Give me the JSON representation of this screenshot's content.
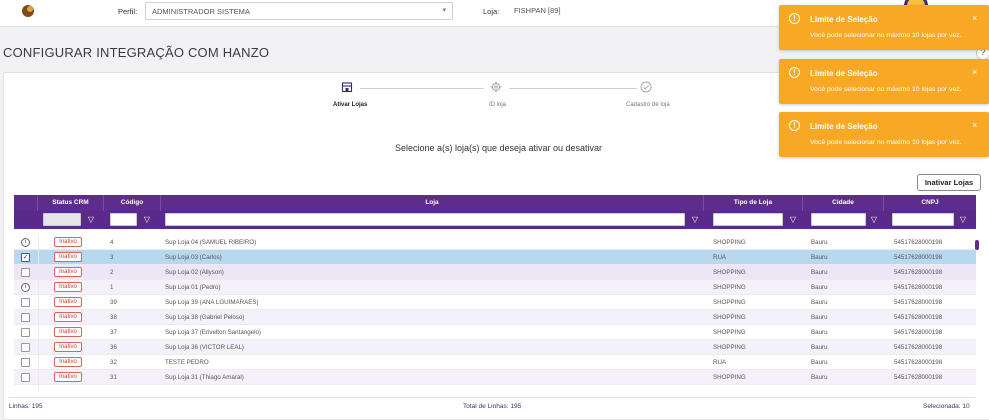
{
  "header": {
    "perfil_label": "Perfil:",
    "perfil_value": "ADMINISTRADOR SISTEMA",
    "loja_label": "Loja:",
    "loja_value": "FISHPAN [89]"
  },
  "page": {
    "title": "CONFIGURAR INTEGRAÇÃO COM HANZO",
    "instruction": "Selecione a(s) loja(s) que deseja ativar ou desativar",
    "inativar_button": "Inativar Lojas"
  },
  "stepper": [
    {
      "label": "Ativar Lojas",
      "icon": "store-icon",
      "active": true
    },
    {
      "label": "ID loja",
      "icon": "gear-icon",
      "active": false
    },
    {
      "label": "Cadastro de loja",
      "icon": "check-circle-icon",
      "active": false
    }
  ],
  "grid": {
    "columns": [
      "Status CRM",
      "Código",
      "Loja",
      "Tipo de Loja",
      "Cidade",
      "CNPJ"
    ],
    "rows": [
      {
        "mark": "info",
        "status": "Inativo",
        "codigo": "4",
        "loja": "Sup Loja 04 (SAMUEL RIBEIRO)",
        "tipo": "SHOPPING",
        "cidade": "Bauru",
        "cnpj": "54517628000198"
      },
      {
        "mark": "checked",
        "status": "Inativo",
        "codigo": "3",
        "loja": "Sup Loja 03 (Carlos)",
        "tipo": "RUA",
        "cidade": "Bauru",
        "cnpj": "54517628000198"
      },
      {
        "mark": "box",
        "status": "Inativo",
        "codigo": "2",
        "loja": "Sup Loja 02 (Allyson)",
        "tipo": "SHOPPING",
        "cidade": "Bauru",
        "cnpj": "54517628000198"
      },
      {
        "mark": "info",
        "status": "Inativo",
        "codigo": "1",
        "loja": "Sup Loja 01 (Pedro)",
        "tipo": "SHOPPING",
        "cidade": "Bauru",
        "cnpj": "54517628000198"
      },
      {
        "mark": "box",
        "status": "Inativo",
        "codigo": "39",
        "loja": "Sup Loja 39 (ANA LGUIMARAES)",
        "tipo": "SHOPPING",
        "cidade": "Bauru",
        "cnpj": "54517628000198"
      },
      {
        "mark": "box",
        "status": "Inativo",
        "codigo": "38",
        "loja": "Sup Loja 38 (Gabriel Peloso)",
        "tipo": "SHOPPING",
        "cidade": "Bauru",
        "cnpj": "54517628000198"
      },
      {
        "mark": "box",
        "status": "Inativo",
        "codigo": "37",
        "loja": "Sup Loja 37 (Erivelton Santangelo)",
        "tipo": "SHOPPING",
        "cidade": "Bauru",
        "cnpj": "54517628000198"
      },
      {
        "mark": "box",
        "status": "Inativo",
        "codigo": "36",
        "loja": "Sup Loja 36 (VICTOR LEAL)",
        "tipo": "SHOPPING",
        "cidade": "Bauru",
        "cnpj": "54517628000198"
      },
      {
        "mark": "box",
        "status": "Inativo",
        "codigo": "32",
        "loja": "TESTE PEDRO",
        "tipo": "RUA",
        "cidade": "Bauru",
        "cnpj": "54517628000198"
      },
      {
        "mark": "box",
        "status": "Inativo",
        "codigo": "31",
        "loja": "Sup Loja 31 (Thiago Amaral)",
        "tipo": "SHOPPING",
        "cidade": "Bauru",
        "cnpj": "54517628000198"
      }
    ]
  },
  "footer": {
    "linhas": "Linhas: 195",
    "total": "Total de Linhas: 195",
    "selecionadas": "Selecionada: 10"
  },
  "toasts": [
    {
      "title": "Limite de Seleção",
      "message": "Você pode selecionar no máximo 10 lojas por vez."
    },
    {
      "title": "Limite de Seleção",
      "message": "Você pode selecionar no máximo 10 lojas por vez."
    },
    {
      "title": "Limite de Seleção",
      "message": "Você pode selecionar no máximo 10 lojas por vez."
    }
  ],
  "colors": {
    "accent": "#5d2c8c",
    "warning": "#f9a825",
    "inactive": "#d33333",
    "selected_row": "#b8d8f0"
  }
}
